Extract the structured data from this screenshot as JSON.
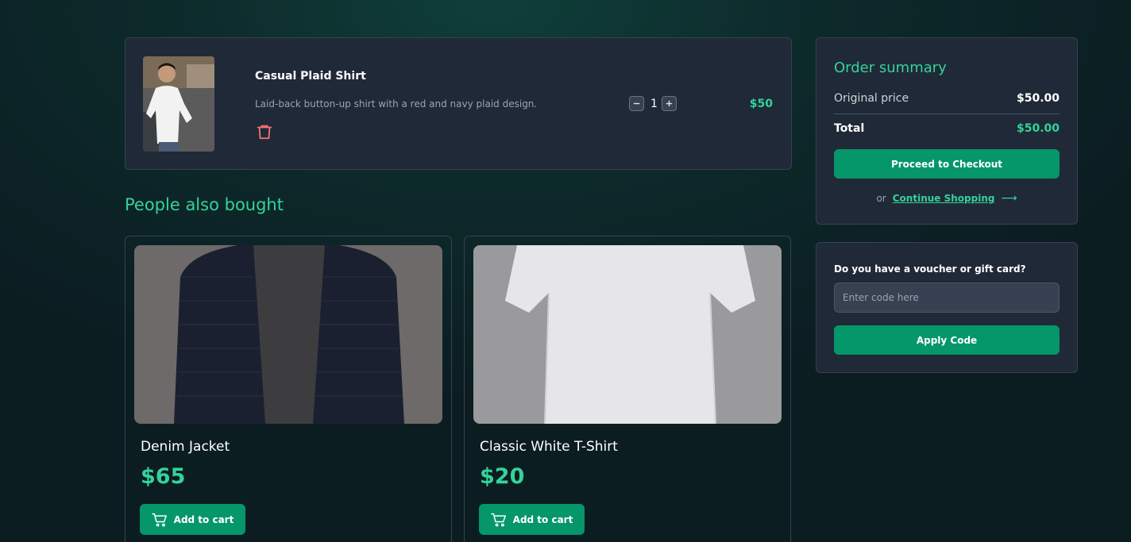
{
  "cart": {
    "item": {
      "name": "Casual Plaid Shirt",
      "description": "Laid-back button-up shirt with a red and navy plaid design.",
      "quantity": "1",
      "price": "$50",
      "image_icon": "person-shirt-photo"
    }
  },
  "recommendations": {
    "title": "People also bought",
    "products": [
      {
        "name": "Denim Jacket",
        "price": "$65",
        "button_label": "Add to cart",
        "image_icon": "jacket-photo"
      },
      {
        "name": "Classic White T-Shirt",
        "price": "$20",
        "button_label": "Add to cart",
        "image_icon": "tshirt-photo"
      }
    ]
  },
  "summary": {
    "title": "Order summary",
    "original_label": "Original price",
    "original_value": "$50.00",
    "total_label": "Total",
    "total_value": "$50.00",
    "checkout_label": "Proceed to Checkout",
    "or_text": "or",
    "continue_label": "Continue Shopping"
  },
  "voucher": {
    "label": "Do you have a voucher or gift card?",
    "placeholder": "Enter code here",
    "value": "",
    "button_label": "Apply Code"
  },
  "colors": {
    "accent": "#34d399",
    "button": "#059669",
    "card": "#1f2937",
    "trash": "#f87171"
  }
}
